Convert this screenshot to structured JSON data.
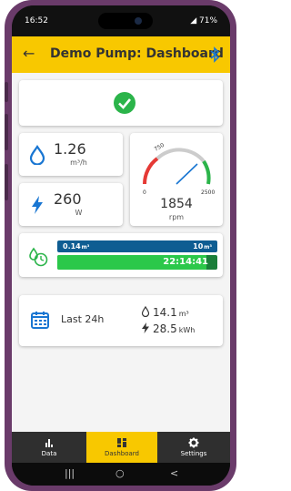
{
  "status_bar": {
    "time": "16:52",
    "indicators": "◢ 71%"
  },
  "app_bar": {
    "title": "Demo Pump: Dashboard",
    "back_icon": "arrow-left-icon",
    "bluetooth_icon": "bluetooth-icon"
  },
  "status": {
    "icon": "check-circle-icon",
    "color": "#2bb44a"
  },
  "flow": {
    "value": "1.26",
    "unit": "m³/h",
    "icon": "water-drop-icon"
  },
  "power": {
    "value": "260",
    "unit": "W",
    "icon": "lightning-icon"
  },
  "rpm": {
    "value": "1854",
    "unit": "rpm",
    "gauge_min": "0",
    "gauge_mark": "750",
    "gauge_max": "2500"
  },
  "progress": {
    "volume_done": "0.14",
    "volume_done_unit": "m³",
    "volume_target": "10",
    "volume_target_unit": "m³",
    "remaining_time": "22:14:41",
    "time_fill_fraction": 0.93,
    "icon": "water-timer-icon"
  },
  "summary": {
    "label": "Last 24h",
    "volume_value": "14.1",
    "volume_unit": "m³",
    "energy_value": "28.5",
    "energy_unit": "kWh",
    "icon": "calendar-icon"
  },
  "nav": {
    "items": [
      {
        "label": "Data",
        "icon": "bar-chart-icon"
      },
      {
        "label": "Dashboard",
        "icon": "dashboard-icon"
      },
      {
        "label": "Settings",
        "icon": "gear-icon"
      }
    ]
  },
  "system_nav": {
    "recent": "|||",
    "home": "○",
    "back": "<"
  },
  "colors": {
    "accent": "#f8c800",
    "blue": "#0e5d92",
    "green": "#2bc84a"
  }
}
